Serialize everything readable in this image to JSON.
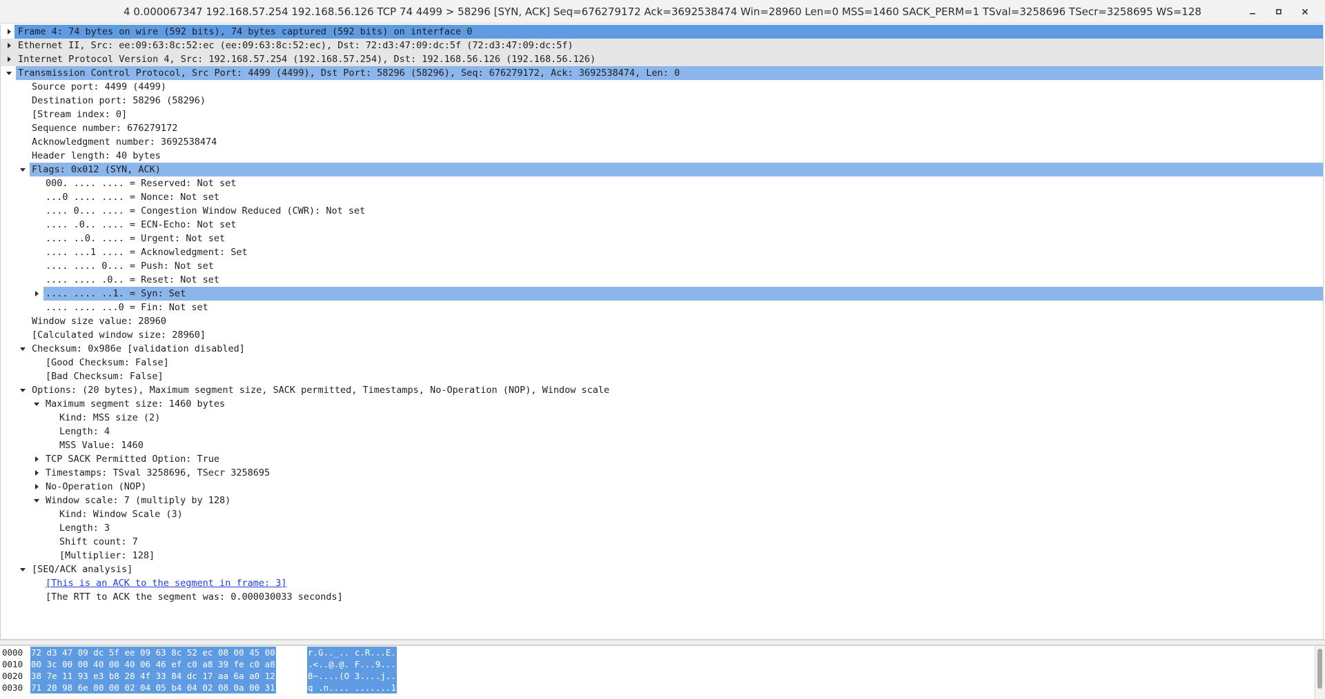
{
  "window": {
    "title": "4 0.000067347 192.168.57.254 192.168.56.126 TCP 74 4499 > 58296 [SYN, ACK] Seq=676279172 Ack=3692538474 Win=28960 Len=0 MSS=1460 SACK_PERM=1 TSval=3258696 TSecr=3258695 WS=128",
    "controls": {
      "minimize_icon": "minimize-icon",
      "maximize_icon": "maximize-icon",
      "close_icon": "close-icon"
    }
  },
  "tree": [
    {
      "text": "Frame 4: 74 bytes on wire (592 bits), 74 bytes captured (592 bits) on interface 0",
      "depth": 0,
      "expander": "collapsed",
      "style": "selected-dark"
    },
    {
      "text": "Ethernet II, Src: ee:09:63:8c:52:ec (ee:09:63:8c:52:ec), Dst: 72:d3:47:09:dc:5f (72:d3:47:09:dc:5f)",
      "depth": 0,
      "expander": "collapsed",
      "style": "header"
    },
    {
      "text": "Internet Protocol Version 4, Src: 192.168.57.254 (192.168.57.254), Dst: 192.168.56.126 (192.168.56.126)",
      "depth": 0,
      "expander": "collapsed",
      "style": "header"
    },
    {
      "text": "Transmission Control Protocol, Src Port: 4499 (4499), Dst Port: 58296 (58296), Seq: 676279172, Ack: 3692538474, Len: 0",
      "depth": 0,
      "expander": "expanded",
      "style": "selected"
    },
    {
      "text": "Source port: 4499 (4499)",
      "depth": 1,
      "expander": "none",
      "style": ""
    },
    {
      "text": "Destination port: 58296 (58296)",
      "depth": 1,
      "expander": "none",
      "style": ""
    },
    {
      "text": "[Stream index: 0]",
      "depth": 1,
      "expander": "none",
      "style": ""
    },
    {
      "text": "Sequence number: 676279172",
      "depth": 1,
      "expander": "none",
      "style": ""
    },
    {
      "text": "Acknowledgment number: 3692538474",
      "depth": 1,
      "expander": "none",
      "style": ""
    },
    {
      "text": "Header length: 40 bytes",
      "depth": 1,
      "expander": "none",
      "style": ""
    },
    {
      "text": "Flags: 0x012 (SYN, ACK)",
      "depth": 1,
      "expander": "expanded",
      "style": "selected"
    },
    {
      "text": "000. .... .... = Reserved: Not set",
      "depth": 2,
      "expander": "none",
      "style": ""
    },
    {
      "text": "...0 .... .... = Nonce: Not set",
      "depth": 2,
      "expander": "none",
      "style": ""
    },
    {
      "text": ".... 0... .... = Congestion Window Reduced (CWR): Not set",
      "depth": 2,
      "expander": "none",
      "style": ""
    },
    {
      "text": ".... .0.. .... = ECN-Echo: Not set",
      "depth": 2,
      "expander": "none",
      "style": ""
    },
    {
      "text": ".... ..0. .... = Urgent: Not set",
      "depth": 2,
      "expander": "none",
      "style": ""
    },
    {
      "text": ".... ...1 .... = Acknowledgment: Set",
      "depth": 2,
      "expander": "none",
      "style": ""
    },
    {
      "text": ".... .... 0... = Push: Not set",
      "depth": 2,
      "expander": "none",
      "style": ""
    },
    {
      "text": ".... .... .0.. = Reset: Not set",
      "depth": 2,
      "expander": "none",
      "style": ""
    },
    {
      "text": ".... .... ..1. = Syn: Set",
      "depth": 2,
      "expander": "collapsed",
      "style": "selected"
    },
    {
      "text": ".... .... ...0 = Fin: Not set",
      "depth": 2,
      "expander": "none",
      "style": ""
    },
    {
      "text": "Window size value: 28960",
      "depth": 1,
      "expander": "none",
      "style": ""
    },
    {
      "text": "[Calculated window size: 28960]",
      "depth": 1,
      "expander": "none",
      "style": ""
    },
    {
      "text": "Checksum: 0x986e [validation disabled]",
      "depth": 1,
      "expander": "expanded",
      "style": ""
    },
    {
      "text": "[Good Checksum: False]",
      "depth": 2,
      "expander": "none",
      "style": ""
    },
    {
      "text": "[Bad Checksum: False]",
      "depth": 2,
      "expander": "none",
      "style": ""
    },
    {
      "text": "Options: (20 bytes), Maximum segment size, SACK permitted, Timestamps, No-Operation (NOP), Window scale",
      "depth": 1,
      "expander": "expanded",
      "style": ""
    },
    {
      "text": "Maximum segment size: 1460 bytes",
      "depth": 2,
      "expander": "expanded",
      "style": ""
    },
    {
      "text": "Kind: MSS size (2)",
      "depth": 3,
      "expander": "none",
      "style": ""
    },
    {
      "text": "Length: 4",
      "depth": 3,
      "expander": "none",
      "style": ""
    },
    {
      "text": "MSS Value: 1460",
      "depth": 3,
      "expander": "none",
      "style": ""
    },
    {
      "text": "TCP SACK Permitted Option: True",
      "depth": 2,
      "expander": "collapsed",
      "style": ""
    },
    {
      "text": "Timestamps: TSval 3258696, TSecr 3258695",
      "depth": 2,
      "expander": "collapsed",
      "style": ""
    },
    {
      "text": "No-Operation (NOP)",
      "depth": 2,
      "expander": "collapsed",
      "style": ""
    },
    {
      "text": "Window scale: 7 (multiply by 128)",
      "depth": 2,
      "expander": "expanded",
      "style": ""
    },
    {
      "text": "Kind: Window Scale (3)",
      "depth": 3,
      "expander": "none",
      "style": ""
    },
    {
      "text": "Length: 3",
      "depth": 3,
      "expander": "none",
      "style": ""
    },
    {
      "text": "Shift count: 7",
      "depth": 3,
      "expander": "none",
      "style": ""
    },
    {
      "text": "[Multiplier: 128]",
      "depth": 3,
      "expander": "none",
      "style": ""
    },
    {
      "text": "[SEQ/ACK analysis]",
      "depth": 1,
      "expander": "expanded",
      "style": ""
    },
    {
      "text": "[This is an ACK to the segment in frame: 3]",
      "depth": 2,
      "expander": "none",
      "style": "link"
    },
    {
      "text": "[The RTT to ACK the segment was: 0.000030033 seconds]",
      "depth": 2,
      "expander": "none",
      "style": ""
    }
  ],
  "hex": [
    {
      "offset": "0000",
      "bytes": "72 d3 47 09 dc 5f ee 09  63 8c 52 ec 08 00 45 00",
      "ascii": "r.G.._.. c.R...E."
    },
    {
      "offset": "0010",
      "bytes": "00 3c 00 00 40 00 40 06  46 ef c0 a8 39 fe c0 a8",
      "ascii": ".<..@.@. F...9..."
    },
    {
      "offset": "0020",
      "bytes": "38 7e 11 93 e3 b8 28 4f  33 84 dc 17 aa 6a a0 12",
      "ascii": "8~....(O 3....j.."
    },
    {
      "offset": "0030",
      "bytes": "71 20 98 6e 00 00 02 04  05 b4 04 02 08 0a 00 31",
      "ascii": "q .n.... .......1"
    }
  ],
  "colors": {
    "selection": "#8ab6ec",
    "selection_dark": "#5f9be3",
    "header_gray": "#e6e6e6",
    "link": "#1f3de0"
  }
}
